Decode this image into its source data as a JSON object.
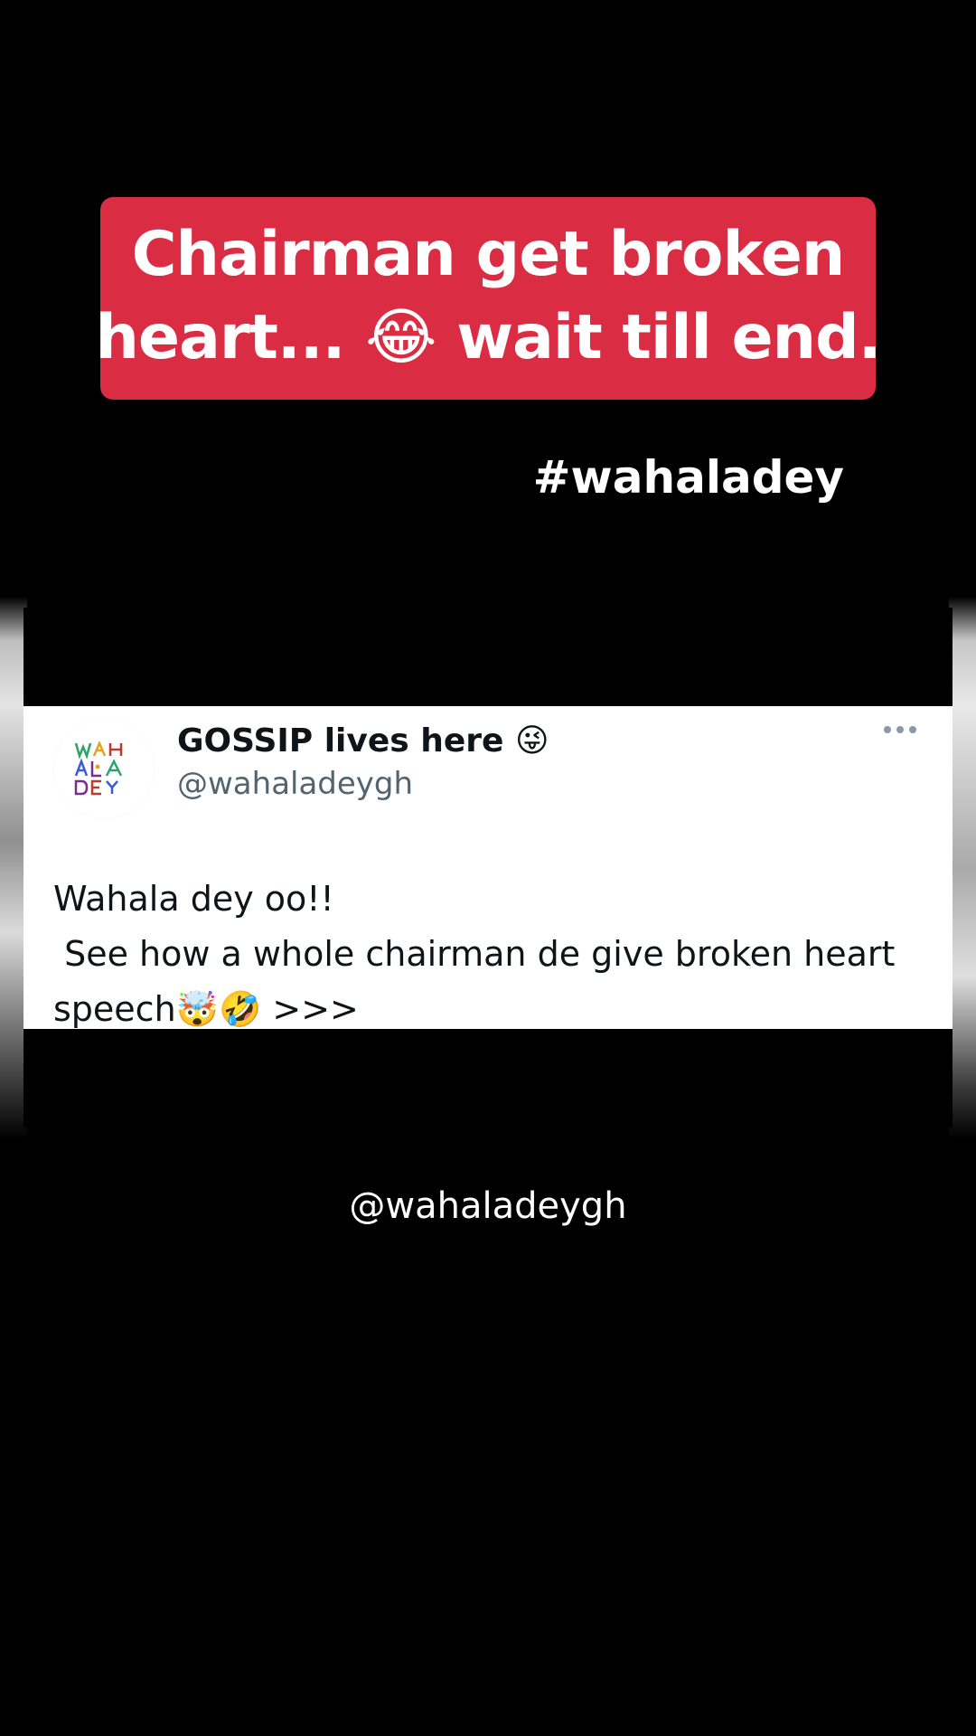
{
  "caption": {
    "line1": "Chairman get broken",
    "line2": "heart... 😂 wait till end."
  },
  "hashtag": "#wahaladey",
  "tweet": {
    "display_name": "GOSSIP lives here 😜",
    "handle": "@wahaladeygh",
    "text": "Wahala dey oo!!\n See how a whole chairman de give broken heart speech🤯🤣 >>>",
    "avatar_icon": "wahaladey-logo-icon",
    "menu_icon": "more-options-icon"
  },
  "watermark": "@wahaladeygh",
  "colors": {
    "banner": "#da2c43",
    "background": "#000000",
    "tweet_bg": "#ffffff",
    "handle_gray": "#536471"
  }
}
